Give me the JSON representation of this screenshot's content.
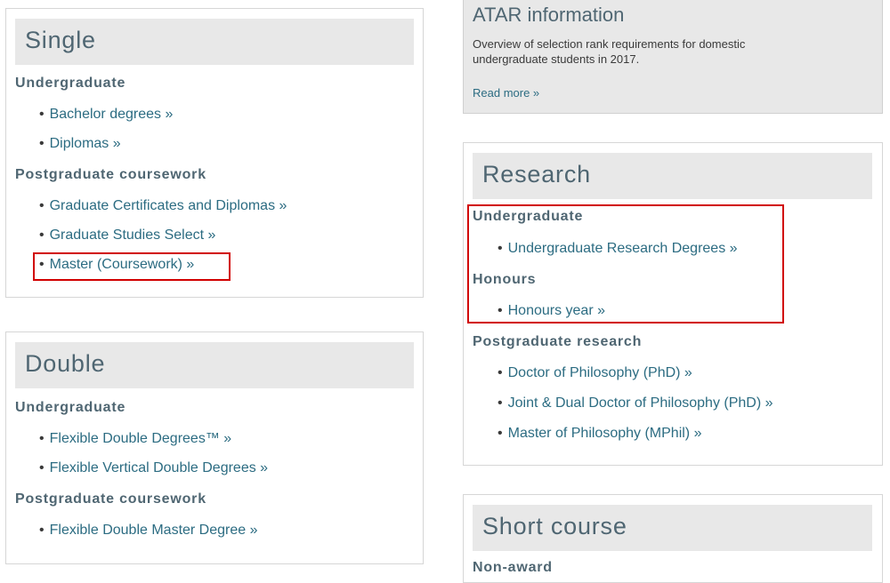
{
  "single": {
    "heading": "Single",
    "groups": [
      {
        "title": "Undergraduate",
        "items": [
          "Bachelor degrees »",
          "Diplomas »"
        ]
      },
      {
        "title": "Postgraduate coursework",
        "items": [
          "Graduate Certificates and Diplomas »",
          "Graduate Studies Select »",
          "Master (Coursework) »"
        ]
      }
    ]
  },
  "double": {
    "heading": "Double",
    "groups": [
      {
        "title": "Undergraduate",
        "items": [
          "Flexible Double Degrees™ »",
          "Flexible Vertical Double Degrees »"
        ]
      },
      {
        "title": "Postgraduate coursework",
        "items": [
          "Flexible Double Master Degree »"
        ]
      }
    ]
  },
  "atar": {
    "title": "ATAR information",
    "description": "Overview of selection rank requirements for domestic undergraduate students in 2017.",
    "read_more": "Read more »"
  },
  "research": {
    "heading": "Research",
    "groups": [
      {
        "title": "Undergraduate",
        "items": [
          "Undergraduate Research Degrees »"
        ]
      },
      {
        "title": "Honours",
        "items": [
          "Honours year »"
        ]
      },
      {
        "title": "Postgraduate research",
        "items": [
          "Doctor of Philosophy (PhD) »",
          "Joint & Dual Doctor of Philosophy (PhD) »",
          "Master of Philosophy (MPhil) »"
        ]
      }
    ]
  },
  "short_course": {
    "heading": "Short course",
    "groups": [
      {
        "title": "Non-award",
        "items": []
      }
    ]
  },
  "bullet_char": "•",
  "colors": {
    "heading_text": "#4f6672",
    "link": "#2c6c82",
    "heading_bar": "#e8e8e8",
    "highlight": "#d10000"
  }
}
